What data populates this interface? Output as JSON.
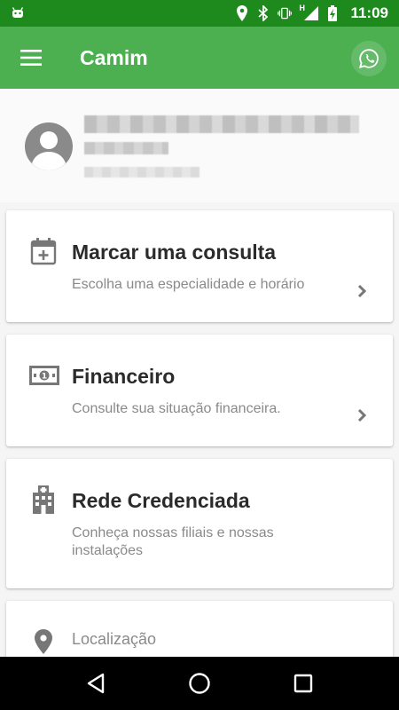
{
  "status_bar": {
    "time": "11:09",
    "network_label": "H"
  },
  "app_bar": {
    "title": "Camim"
  },
  "profile": {
    "name": "",
    "subtitle": ""
  },
  "cards": [
    {
      "title": "Marcar uma consulta",
      "subtitle": "Escolha uma especialidade e horário",
      "icon": "calendar-add-icon"
    },
    {
      "title": "Financeiro",
      "subtitle": "Consulte sua situação financeira.",
      "icon": "money-icon"
    },
    {
      "title": "Rede Credenciada",
      "subtitle": "Conheça nossas filiais e nossas instalações",
      "icon": "hospital-icon"
    }
  ],
  "location": {
    "label": "Localização",
    "icon": "location-pin-icon"
  },
  "colors": {
    "status_bar": "#1e8a1e",
    "app_bar": "#4caf50",
    "background": "#f5f5f5"
  }
}
